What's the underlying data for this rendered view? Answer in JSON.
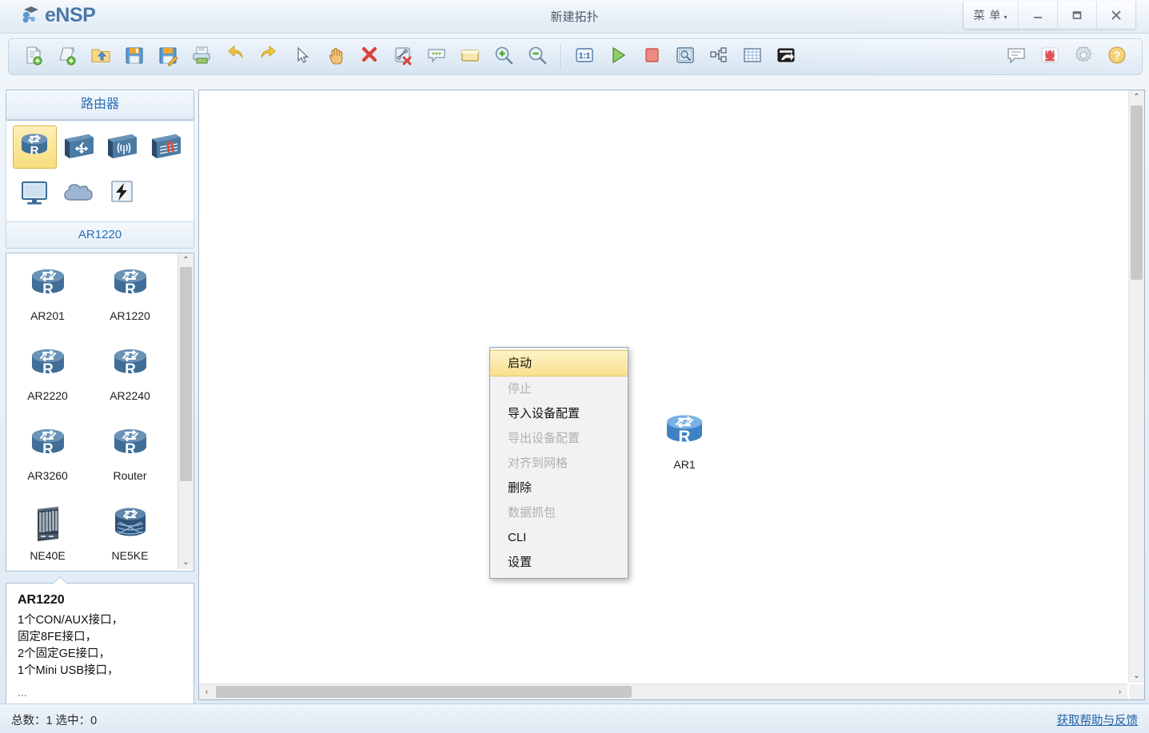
{
  "window": {
    "brand": "eNSP",
    "title": "新建拓扑",
    "buttons": {
      "menu_label": "菜 单",
      "menu_caret": "▾",
      "minimize": "minimize-icon",
      "maximize": "maximize-icon",
      "close": "close-icon"
    }
  },
  "toolbar": {
    "left_items": [
      {
        "name": "new-topology-icon",
        "tooltip": "新建拓扑"
      },
      {
        "name": "new-device-icon",
        "tooltip": "新建设备"
      },
      {
        "name": "open-icon",
        "tooltip": "打开"
      },
      {
        "name": "save-icon",
        "tooltip": "保存"
      },
      {
        "name": "save-as-icon",
        "tooltip": "另存为"
      },
      {
        "name": "print-icon",
        "tooltip": "打印"
      },
      {
        "name": "undo-icon",
        "tooltip": "撤销"
      },
      {
        "name": "redo-icon",
        "tooltip": "重做"
      },
      {
        "name": "select-cursor-icon",
        "tooltip": "选择"
      },
      {
        "name": "pan-hand-icon",
        "tooltip": "拖动"
      },
      {
        "name": "delete-icon",
        "tooltip": "删除"
      },
      {
        "name": "delete-link-icon",
        "tooltip": "删除连线"
      },
      {
        "name": "add-text-icon",
        "tooltip": "添加文本"
      },
      {
        "name": "add-shape-icon",
        "tooltip": "添加图形"
      },
      {
        "name": "zoom-in-icon",
        "tooltip": "放大"
      },
      {
        "name": "zoom-out-icon",
        "tooltip": "缩小"
      },
      {
        "name": "actual-size-icon",
        "tooltip": "恢复原始大小"
      },
      {
        "name": "start-device-icon",
        "tooltip": "开启设备"
      },
      {
        "name": "stop-device-icon",
        "tooltip": "关闭设备"
      },
      {
        "name": "capture-packet-icon",
        "tooltip": "数据抓包"
      },
      {
        "name": "topology-tree-icon",
        "tooltip": "拓扑树"
      },
      {
        "name": "grid-icon",
        "tooltip": "显示网格"
      },
      {
        "name": "screenshot-icon",
        "tooltip": "截图"
      }
    ],
    "right_items": [
      {
        "name": "comment-icon",
        "tooltip": "评论"
      },
      {
        "name": "huawei-logo-icon",
        "tooltip": "华为"
      },
      {
        "name": "settings-gear-icon",
        "tooltip": "设置"
      },
      {
        "name": "help-icon",
        "tooltip": "帮助"
      }
    ]
  },
  "sidebar": {
    "category_title": "路由器",
    "device_types": [
      {
        "name": "router-type-icon",
        "label": "路由器",
        "selected": true
      },
      {
        "name": "switch-type-icon",
        "label": "交换机",
        "selected": false
      },
      {
        "name": "wlan-type-icon",
        "label": "无线局域网",
        "selected": false
      },
      {
        "name": "firewall-type-icon",
        "label": "防火墙",
        "selected": false
      },
      {
        "name": "terminal-type-icon",
        "label": "终端",
        "selected": false
      },
      {
        "name": "cloud-type-icon",
        "label": "其它设备",
        "selected": false
      },
      {
        "name": "connection-type-icon",
        "label": "设备连线",
        "selected": false
      }
    ],
    "model_label": "AR1220",
    "models": [
      {
        "name": "AR201"
      },
      {
        "name": "AR1220"
      },
      {
        "name": "AR2220"
      },
      {
        "name": "AR2240"
      },
      {
        "name": "AR3260"
      },
      {
        "name": "Router"
      },
      {
        "name": "NE40E"
      },
      {
        "name": "NE5KE"
      }
    ],
    "description": {
      "title": "AR1220",
      "lines": [
        "1个CON/AUX接口，",
        "固定8FE接口，",
        "2个固定GE接口，",
        "1个Mini USB接口，"
      ],
      "ellipsis": "..."
    },
    "scroll": {
      "up_arrow": "⌃",
      "down_arrow": "⌄"
    }
  },
  "canvas": {
    "nodes": [
      {
        "label": "AR1",
        "type": "router-node-icon"
      }
    ],
    "scroll": {
      "up_arrow": "⌃",
      "down_arrow": "⌄",
      "left_arrow": "‹",
      "right_arrow": "›"
    }
  },
  "context_menu": {
    "items": [
      {
        "label": "启动",
        "state": "highlight"
      },
      {
        "label": "停止",
        "state": "disabled"
      },
      {
        "label": "导入设备配置",
        "state": "normal"
      },
      {
        "label": "导出设备配置",
        "state": "disabled"
      },
      {
        "label": "对齐到网格",
        "state": "disabled"
      },
      {
        "label": "删除",
        "state": "normal"
      },
      {
        "label": "数据抓包",
        "state": "disabled"
      },
      {
        "label": "CLI",
        "state": "normal"
      },
      {
        "label": "设置",
        "state": "normal"
      }
    ]
  },
  "statusbar": {
    "counts": "总数：1  选中：0",
    "help_link": "获取帮助与反馈"
  },
  "colors": {
    "accent": "#2f6fb5",
    "highlight": "#f9e08f",
    "router_blue": "#3f6f98",
    "selected_node_blue": "#4d8fd0",
    "link": "#2060a8"
  }
}
